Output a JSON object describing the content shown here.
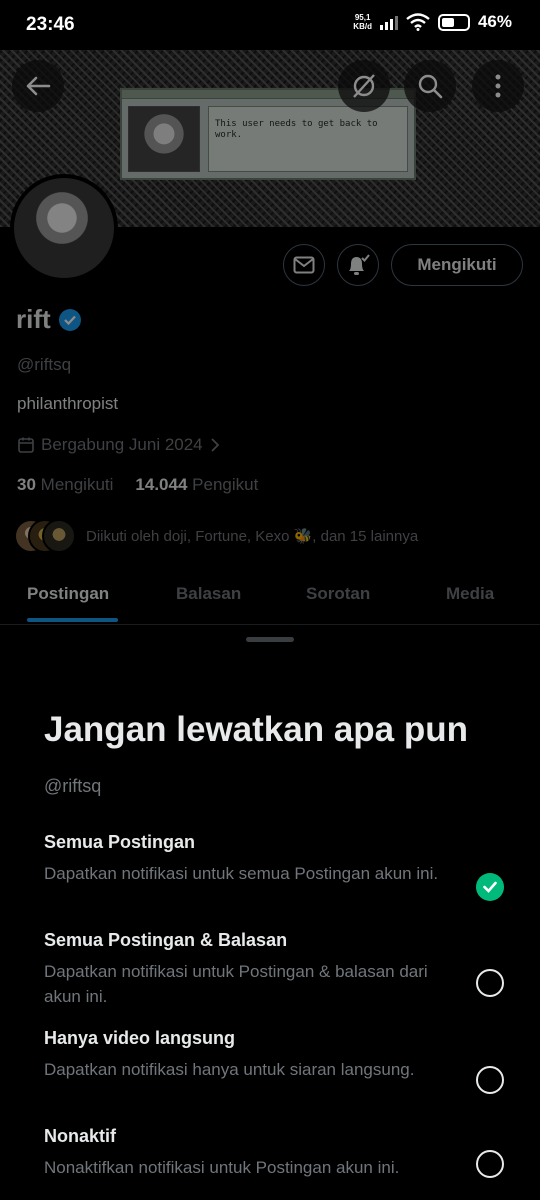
{
  "status_bar": {
    "time": "23:46",
    "net_speed_value": "95,1",
    "net_speed_unit": "KB/d",
    "battery": "46%"
  },
  "profile": {
    "banner_text": "This user needs to get back to work.",
    "display_name": "rift",
    "handle": "@riftsq",
    "bio": "philanthropist",
    "joined": "Bergabung Juni 2024",
    "following_count": "30",
    "following_label": "Mengikuti",
    "followers_count": "14.044",
    "followers_label": "Pengikut",
    "followed_by": "Diikuti oleh doji, Fortune, Kexo 🐝, dan 15 lainnya",
    "follow_button": "Mengikuti",
    "verified_color": "#1d9bf0"
  },
  "tabs": [
    {
      "label": "Postingan",
      "active": true
    },
    {
      "label": "Balasan",
      "active": false
    },
    {
      "label": "Sorotan",
      "active": false
    },
    {
      "label": "Media",
      "active": false
    }
  ],
  "sheet": {
    "title": "Jangan lewatkan apa pun",
    "handle": "@riftsq",
    "options": [
      {
        "title": "Semua Postingan",
        "desc": "Dapatkan notifikasi untuk semua Postingan akun ini.",
        "selected": true
      },
      {
        "title": "Semua Postingan & Balasan",
        "desc": "Dapatkan notifikasi untuk Postingan & balasan dari akun ini.",
        "selected": false
      },
      {
        "title": "Hanya video langsung",
        "desc": "Dapatkan notifikasi hanya untuk siaran langsung.",
        "selected": false
      },
      {
        "title": "Nonaktif",
        "desc": "Nonaktifkan notifikasi untuk Postingan akun ini.",
        "selected": false
      }
    ],
    "accent_color": "#00ba7c"
  }
}
